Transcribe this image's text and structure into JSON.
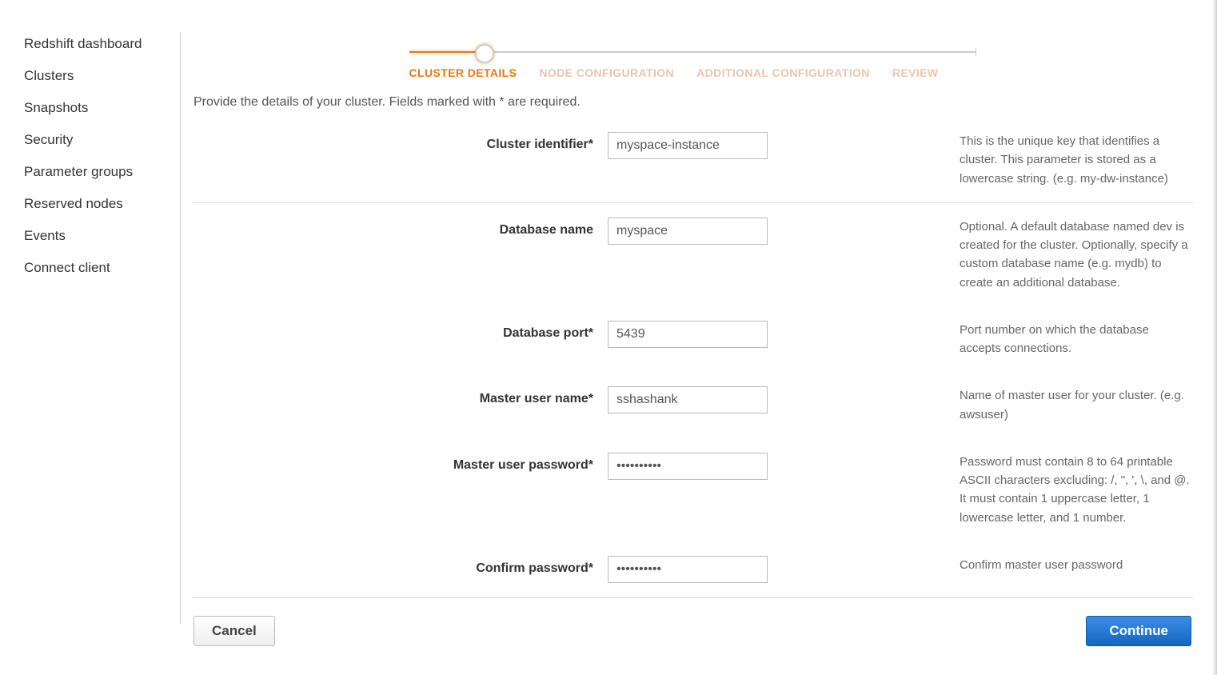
{
  "sidebar": {
    "items": [
      {
        "label": "Redshift dashboard"
      },
      {
        "label": "Clusters"
      },
      {
        "label": "Snapshots"
      },
      {
        "label": "Security"
      },
      {
        "label": "Parameter groups"
      },
      {
        "label": "Reserved nodes"
      },
      {
        "label": "Events"
      },
      {
        "label": "Connect client"
      }
    ]
  },
  "wizard": {
    "steps": [
      {
        "label": "CLUSTER DETAILS",
        "active": true
      },
      {
        "label": "NODE CONFIGURATION"
      },
      {
        "label": "ADDITIONAL CONFIGURATION"
      },
      {
        "label": "REVIEW"
      }
    ]
  },
  "intro": "Provide the details of your cluster. Fields marked with * are required.",
  "form": {
    "cluster_identifier": {
      "label": "Cluster identifier*",
      "value": "myspace-instance",
      "help": "This is the unique key that identifies a cluster. This parameter is stored as a lowercase string. (e.g. my-dw-instance)"
    },
    "database_name": {
      "label": "Database name",
      "value": "myspace",
      "help": "Optional. A default database named dev is created for the cluster. Optionally, specify a custom database name (e.g. mydb) to create an additional database."
    },
    "database_port": {
      "label": "Database port*",
      "value": "5439",
      "help": "Port number on which the database accepts connections."
    },
    "master_user_name": {
      "label": "Master user name*",
      "value": "sshashank",
      "help": "Name of master user for your cluster. (e.g. awsuser)"
    },
    "master_user_password": {
      "label": "Master user password*",
      "value": "••••••••••",
      "help": "Password must contain 8 to 64 printable ASCII characters excluding: /, \", ', \\, and @. It must contain 1 uppercase letter, 1 lowercase letter, and 1 number."
    },
    "confirm_password": {
      "label": "Confirm password*",
      "value": "••••••••••",
      "help": "Confirm master user password"
    }
  },
  "footer": {
    "cancel_label": "Cancel",
    "continue_label": "Continue"
  }
}
